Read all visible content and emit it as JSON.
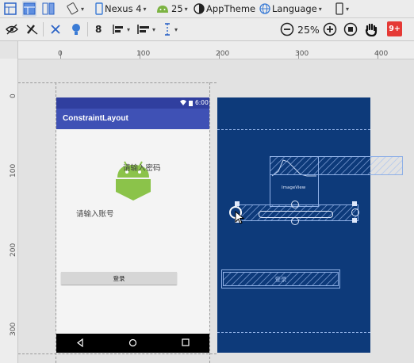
{
  "toolbar_top": {
    "device": "Nexus 4",
    "api_level": "25",
    "theme": "AppTheme",
    "language": "Language"
  },
  "toolbar_second": {
    "margin_value": "8",
    "zoom": "25%",
    "notifications": "9+"
  },
  "ruler": {
    "h_labels": [
      "0",
      "100",
      "200",
      "300",
      "400"
    ],
    "v_labels": [
      "0",
      "100",
      "200",
      "300"
    ]
  },
  "phone": {
    "status_time": "6:00",
    "app_title": "ConstraintLayout",
    "text_password": "请输入密码",
    "text_account": "请输入账号",
    "login_button": "登录"
  },
  "blueprint": {
    "imageview_label": "ImageView",
    "login_button": "登录"
  },
  "colors": {
    "blueprint_bg": "#0d3a7a",
    "app_bar": "#3f51b5",
    "status_bar": "#303f9f",
    "badge": "#e53935"
  }
}
